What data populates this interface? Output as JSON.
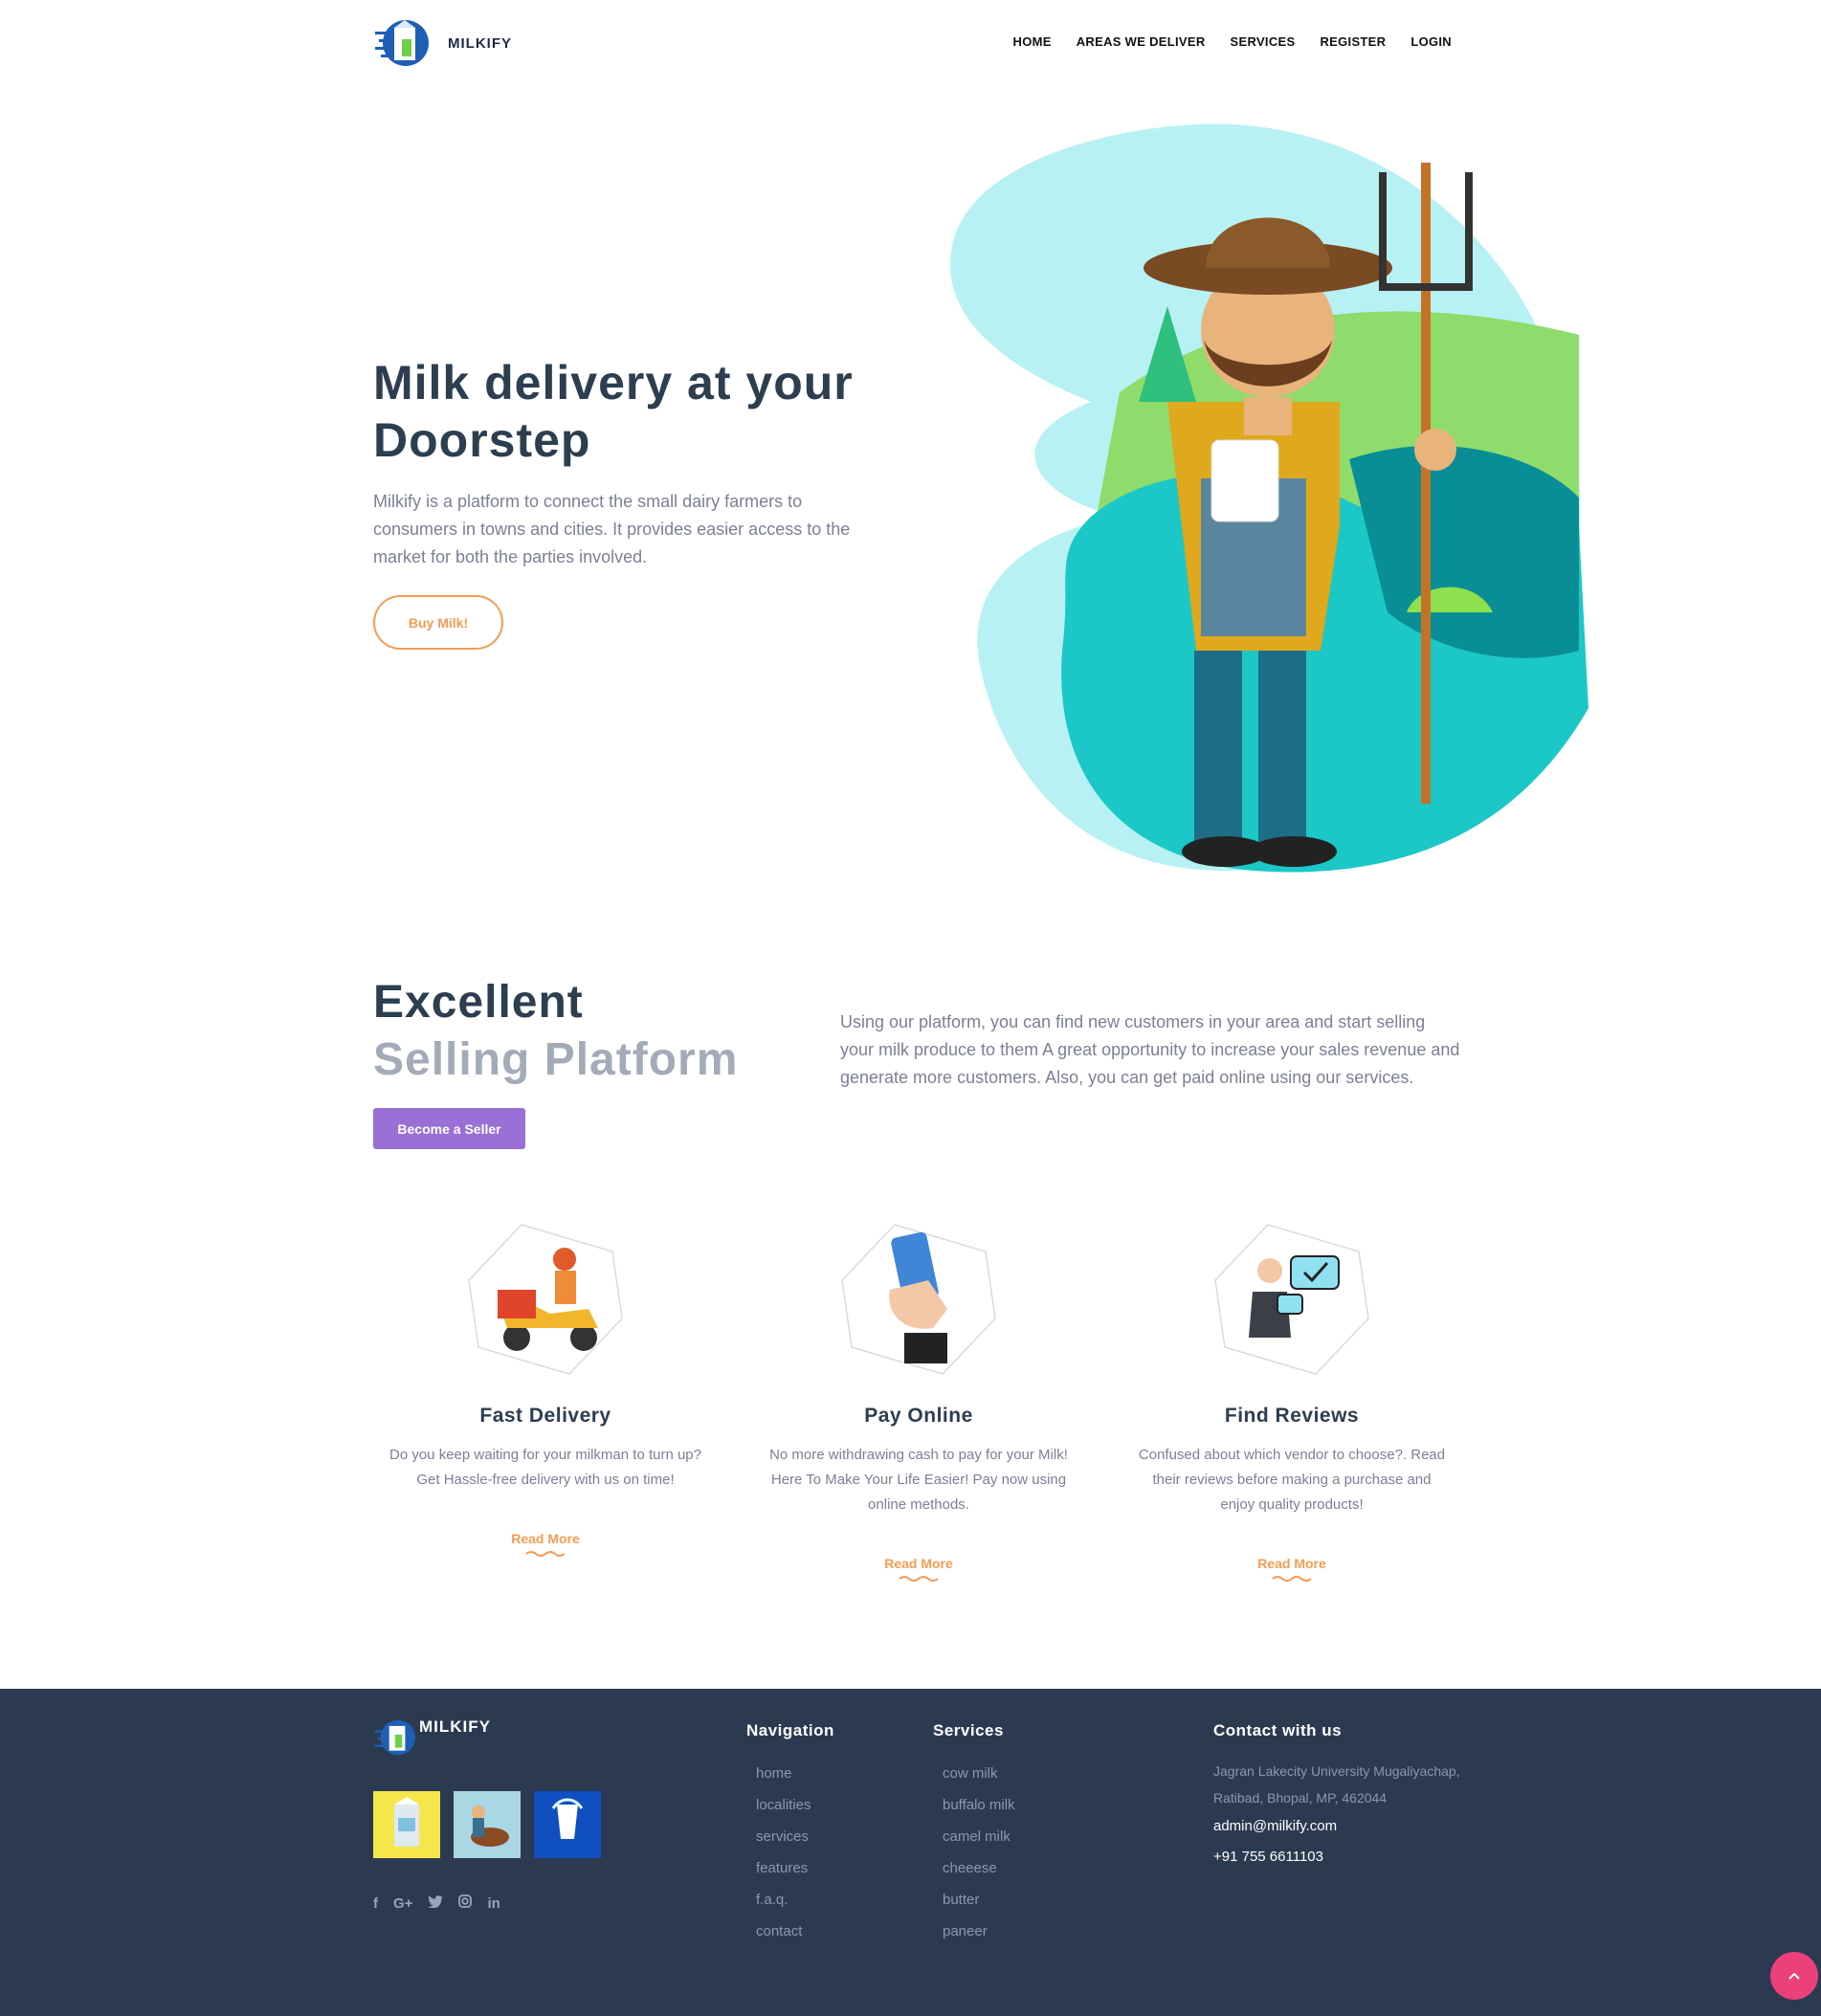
{
  "brand": {
    "name": "MILKIFY"
  },
  "nav": {
    "items": [
      "HOME",
      "AREAS WE DELIVER",
      "SERVICES",
      "REGISTER",
      "LOGIN"
    ]
  },
  "hero": {
    "title": "Milk delivery at your Doorstep",
    "text": "Milkify is a platform to connect the small dairy farmers to consumers in towns and cities. It provides easier access to the market for both the parties involved.",
    "button": "Buy Milk!"
  },
  "platform": {
    "title_line1": "Excellent",
    "title_line2": "Selling Platform",
    "button": "Become a Seller",
    "text": "Using our platform, you can find new customers in your area and start selling your milk produce to them A great opportunity to increase your sales revenue and generate more customers. Also, you can get paid online using our services."
  },
  "features": [
    {
      "title": "Fast Delivery",
      "text": "Do you keep waiting for your milkman to turn up? Get Hassle-free delivery with us on time!",
      "link": "Read More",
      "icon": "delivery-scooter-icon"
    },
    {
      "title": "Pay Online",
      "text": "No more withdrawing cash to pay for your Milk! Here To Make Your Life Easier! Pay now using online methods.",
      "link": "Read More",
      "icon": "phone-payment-icon"
    },
    {
      "title": "Find Reviews",
      "text": "Confused about which vendor to choose?. Read their reviews before making a purchase and enjoy quality products!",
      "link": "Read More",
      "icon": "review-chat-icon"
    }
  ],
  "footer": {
    "brand": "MILKIFY",
    "social": [
      "f",
      "G+",
      "tw",
      "ig",
      "in"
    ],
    "navigation": {
      "title": "Navigation",
      "items": [
        "home",
        "localities",
        "services",
        "features",
        "f.a.q.",
        "contact"
      ]
    },
    "services": {
      "title": "Services",
      "items": [
        "cow milk",
        "buffalo milk",
        "camel milk",
        "cheeese",
        "butter",
        "paneer"
      ]
    },
    "contact": {
      "title": "Contact with us",
      "address": "Jagran Lakecity University Mugaliyachap, Ratibad, Bhopal, MP, 462044",
      "email": "admin@milkify.com",
      "phone": "+91 755 6611103"
    }
  },
  "colors": {
    "accent_orange": "#f39c53",
    "seller_purple": "#9a6fd6",
    "footer_bg": "#2c3a51",
    "to_top": "#ec407a"
  }
}
